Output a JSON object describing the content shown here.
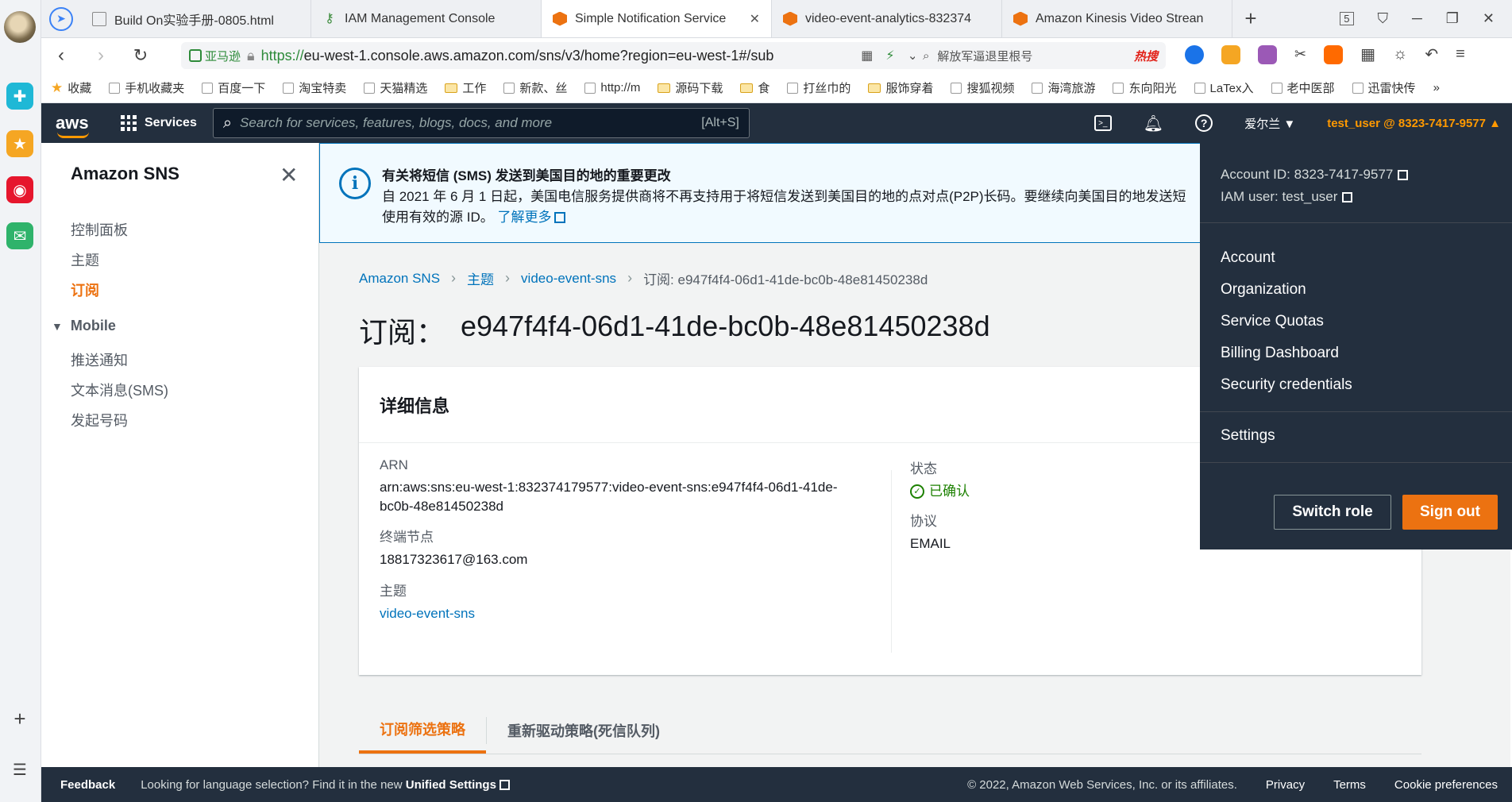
{
  "browser": {
    "tabs": [
      {
        "label": "Build On实验手册-0805.html",
        "icon": "doc-icon"
      },
      {
        "label": "IAM Management Console",
        "icon": "key-icon"
      },
      {
        "label": "Simple Notification Service",
        "icon": "aws-icon",
        "active": true
      },
      {
        "label": "video-event-analytics-832374",
        "icon": "aws-icon"
      },
      {
        "label": "Amazon Kinesis Video Strean",
        "icon": "aws-icon"
      }
    ],
    "tab_counter": "5",
    "cert_label": "亚马逊",
    "url_scheme": "https://",
    "url_rest": "eu-west-1.console.aws.amazon.com/sns/v3/home?region=eu-west-1#/sub",
    "search_placeholder": "解放军逼退里根号",
    "hot_label": "热搜",
    "bookmarks": [
      {
        "label": "收藏",
        "icon": "star"
      },
      {
        "label": "手机收藏夹",
        "icon": "doc"
      },
      {
        "label": "百度一下",
        "icon": "doc"
      },
      {
        "label": "淘宝特卖",
        "icon": "doc"
      },
      {
        "label": "天猫精选",
        "icon": "doc"
      },
      {
        "label": "工作",
        "icon": "folder"
      },
      {
        "label": "新款、丝",
        "icon": "doc"
      },
      {
        "label": "http://m",
        "icon": "doc"
      },
      {
        "label": "源码下载",
        "icon": "folder"
      },
      {
        "label": "食",
        "icon": "folder"
      },
      {
        "label": "打丝巾的",
        "icon": "doc"
      },
      {
        "label": "服饰穿着",
        "icon": "folder"
      },
      {
        "label": "搜狐视频",
        "icon": "doc"
      },
      {
        "label": "海湾旅游",
        "icon": "doc"
      },
      {
        "label": "东向阳光",
        "icon": "doc"
      },
      {
        "label": "LaTex入",
        "icon": "doc"
      },
      {
        "label": "老中医部",
        "icon": "doc"
      },
      {
        "label": "迅雷快传",
        "icon": "doc"
      }
    ],
    "bookmarks_more": "»"
  },
  "aws_nav": {
    "logo": "aws",
    "services_label": "Services",
    "search_placeholder": "Search for services, features, blogs, docs, and more",
    "search_shortcut": "[Alt+S]",
    "region": "爱尔兰",
    "user": "test_user @ 8323-7417-9577"
  },
  "sidebar": {
    "title": "Amazon SNS",
    "items": [
      {
        "label": "控制面板"
      },
      {
        "label": "主题"
      },
      {
        "label": "订阅",
        "active": true
      }
    ],
    "section": "Mobile",
    "mobile_items": [
      {
        "label": "推送通知"
      },
      {
        "label": "文本消息(SMS)"
      },
      {
        "label": "发起号码"
      }
    ]
  },
  "flash": {
    "title": "有关将短信 (SMS) 发送到美国目的地的重要更改",
    "body": "自 2021 年 6 月 1 日起，美国电信服务提供商将不再支持用于将短信发送到美国目的地的点对点(P2P)长码。要继续向美国目的地发送短",
    "body2": "使用有效的源 ID。",
    "link": "了解更多"
  },
  "breadcrumb": [
    "Amazon SNS",
    "主题",
    "video-event-sns",
    "订阅: e947f4f4-06d1-41de-bc0b-48e81450238d"
  ],
  "page_title": {
    "prefix": "订阅：",
    "id": "e947f4f4-06d1-41de-bc0b-48e81450238d"
  },
  "details": {
    "header": "详细信息",
    "arn_label": "ARN",
    "arn_line1": "arn:aws:sns:eu-west-1:832374179577:video-event-sns:e947f4f4-06d1-41de-",
    "arn_line2": "bc0b-48e81450238d",
    "endpoint_label": "终端节点",
    "endpoint_value": "18817323617@163.com",
    "topic_label": "主题",
    "topic_value": "video-event-sns",
    "status_label": "状态",
    "status_value": "已确认",
    "protocol_label": "协议",
    "protocol_value": "EMAIL"
  },
  "sub_tabs": [
    "订阅筛选策略",
    "重新驱动策略(死信队列)"
  ],
  "account_menu": {
    "account_id": "Account ID: 8323-7417-9577",
    "iam_user": "IAM user: test_user",
    "items": [
      "Account",
      "Organization",
      "Service Quotas",
      "Billing Dashboard",
      "Security credentials"
    ],
    "settings": "Settings",
    "switch_role": "Switch role",
    "sign_out": "Sign out"
  },
  "footer": {
    "feedback": "Feedback",
    "lang_text": "Looking for language selection? Find it in the new ",
    "lang_link": "Unified Settings",
    "copyright": "© 2022, Amazon Web Services, Inc. or its affiliates.",
    "links": [
      "Privacy",
      "Terms",
      "Cookie preferences"
    ]
  },
  "colors": {
    "aws_dark": "#232f3e",
    "aws_orange": "#ec7211",
    "link_blue": "#0073bb",
    "success_green": "#1d8102"
  }
}
